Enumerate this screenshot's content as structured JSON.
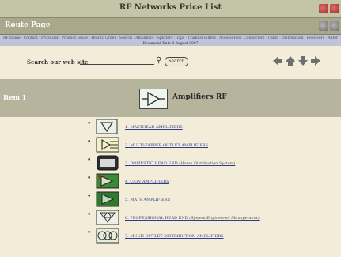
{
  "window": {
    "title": "RF Networks Price List"
  },
  "header": {
    "page_label": "Route Page"
  },
  "linkbar": {
    "links_text": "RF Home · Contact · Price List · Product Guide · How to Order · Search · Amplifiers · Splitters · Taps · Channel Filters · Accessories · Connectors · Cable · Distribution · Receivers · Antennas · Catalogue",
    "updated": "Document Date 8 August 2007"
  },
  "search": {
    "label": "Search our web site",
    "value": "",
    "placeholder": "",
    "button_label": "Search"
  },
  "section": {
    "label": "Item 1",
    "title": "Amplifiers RF"
  },
  "items": [
    {
      "text": "1. MASTHEAD AMPLIFIERS",
      "note": ""
    },
    {
      "text": "2. MULTI-TAPPER OUTLET AMPLIFIERS",
      "note": ""
    },
    {
      "text": "3. DOMESTIC HEAD END",
      "note": "(Home Distribution System)"
    },
    {
      "text": "4. CATV AMPLIFIERS",
      "note": ""
    },
    {
      "text": "5. MATV AMPLIFIERS",
      "note": ""
    },
    {
      "text": "6. PROFESSIONAL HEAD END",
      "note": "(System Engineered Management)"
    },
    {
      "text": "7. MULTI-OUTLET DISTRIBUTION AMPLIFIERS",
      "note": ""
    }
  ],
  "colors": {
    "background": "#f2ecd8",
    "titlebar": "#c4c4a8",
    "homebar": "#aaa88a",
    "section_bar": "#b7b49d",
    "link": "#2f3c8e",
    "nav_red": "#b03a33"
  },
  "icons": [
    "back-arrow-icon",
    "home-arrow-icon",
    "up-arrow-icon",
    "forward-arrow-icon",
    "magnifier-icon",
    "amplifier-icon"
  ]
}
